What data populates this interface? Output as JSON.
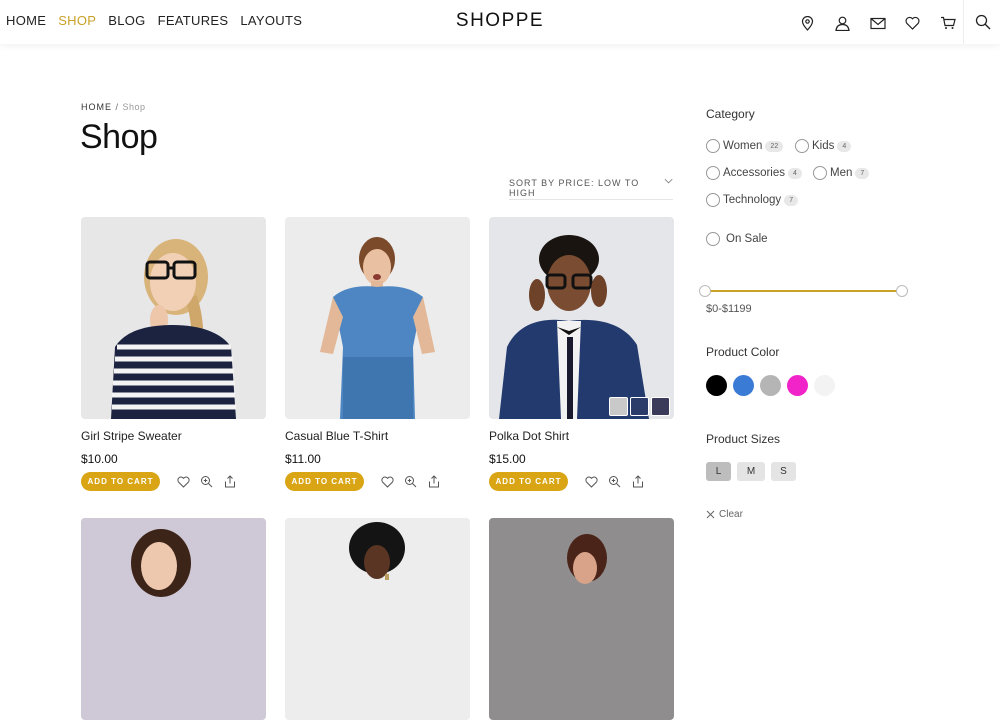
{
  "header": {
    "brand": "SHOPPE",
    "nav": [
      {
        "label": "HOME",
        "active": false
      },
      {
        "label": "SHOP",
        "active": true
      },
      {
        "label": "BLOG",
        "active": false
      },
      {
        "label": "FEATURES",
        "active": false
      },
      {
        "label": "LAYOUTS",
        "active": false
      }
    ],
    "icons": [
      "location-icon",
      "user-icon",
      "mail-icon",
      "heart-icon",
      "cart-icon",
      "search-icon"
    ]
  },
  "breadcrumb": {
    "home": "HOME",
    "separator": " / ",
    "current": "Shop"
  },
  "page_title": "Shop",
  "sort": {
    "label": "SORT BY PRICE: LOW TO HIGH"
  },
  "products": [
    {
      "name": "Girl Stripe Sweater",
      "price": "$10.00",
      "cta": "ADD TO CART"
    },
    {
      "name": "Casual Blue T-Shirt",
      "price": "$11.00",
      "cta": "ADD TO CART"
    },
    {
      "name": "Polka Dot Shirt",
      "price": "$15.00",
      "cta": "ADD TO CART"
    },
    {
      "name": "",
      "price": "",
      "cta": ""
    },
    {
      "name": "",
      "price": "",
      "cta": ""
    },
    {
      "name": "",
      "price": "",
      "cta": ""
    }
  ],
  "sidebar": {
    "category_title": "Category",
    "categories": [
      {
        "label": "Women",
        "count": "22"
      },
      {
        "label": "Kids",
        "count": "4"
      },
      {
        "label": "Accessories",
        "count": "4"
      },
      {
        "label": "Men",
        "count": "7"
      },
      {
        "label": "Technology",
        "count": "7"
      }
    ],
    "on_sale": "On Sale",
    "price_range": "$0-$1199",
    "color_title": "Product Color",
    "colors": [
      "#000000",
      "#3a7bd5",
      "#b5b5b5",
      "#f024c8",
      "#f3f3f3"
    ],
    "size_title": "Product Sizes",
    "sizes": [
      {
        "label": "L",
        "selected": true
      },
      {
        "label": "M",
        "selected": false
      },
      {
        "label": "S",
        "selected": false
      }
    ],
    "clear": "Clear"
  },
  "colors": {
    "accent": "#c9a227",
    "button": "#d9a514"
  }
}
